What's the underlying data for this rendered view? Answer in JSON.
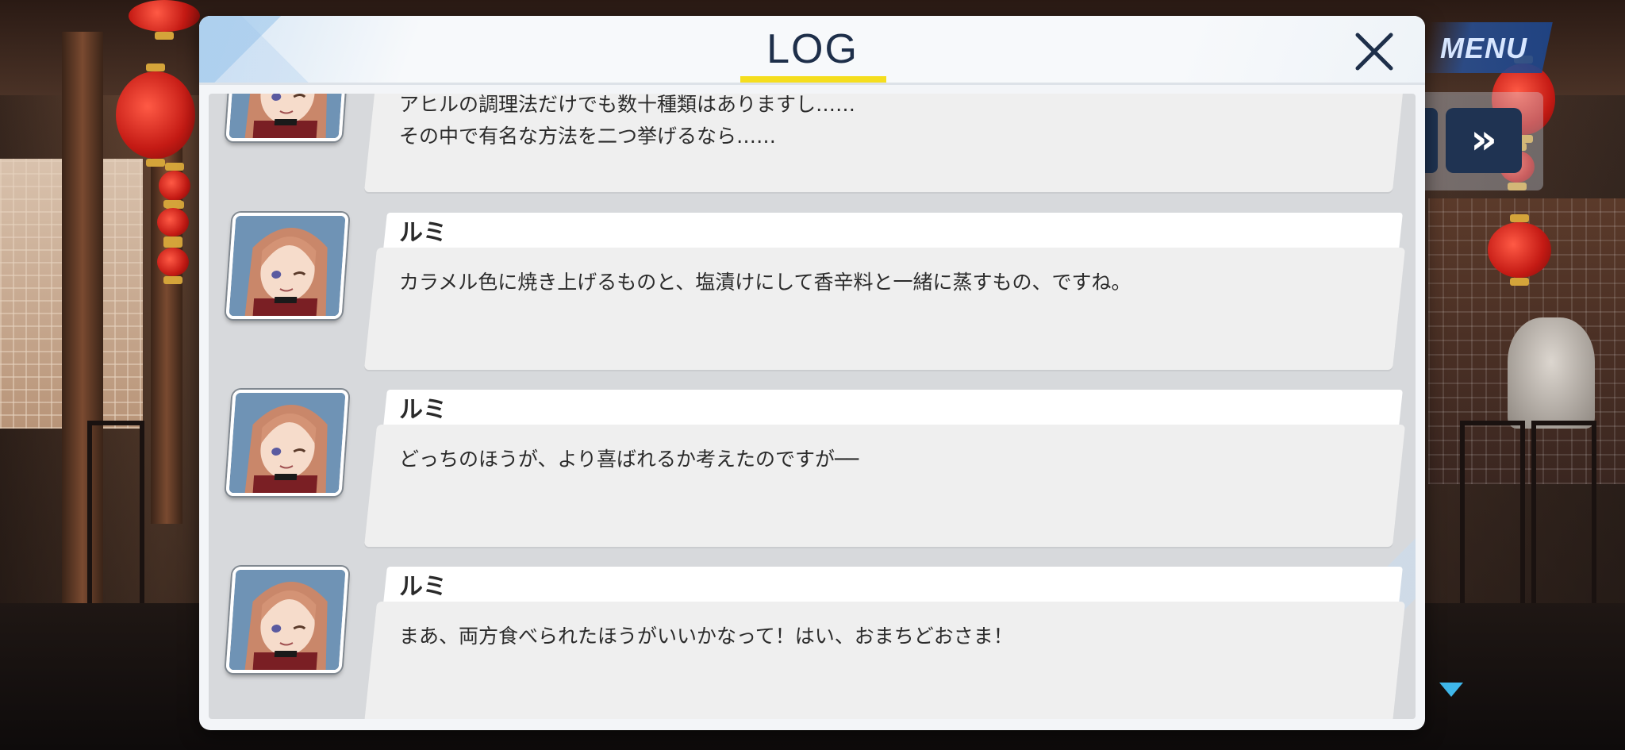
{
  "hud": {
    "menu_label": "MENU",
    "skip_glyph": "»"
  },
  "log": {
    "title": "LOG",
    "close_glyph": "×",
    "entries": [
      {
        "speaker": "",
        "text": "アヒルの調理法だけでも数十種類はありますし……\nその中で有名な方法を二つ挙げるなら……"
      },
      {
        "speaker": "ルミ",
        "text": "カラメル色に焼き上げるものと、塩漬けにして香辛料と一緒に蒸すもの、ですね。"
      },
      {
        "speaker": "ルミ",
        "text": "どっちのほうが、より喜ばれるか考えたのですが──"
      },
      {
        "speaker": "ルミ",
        "text": "まあ、両方食べられたほうがいいかなって！はい、おまちどおさま！"
      }
    ]
  },
  "colors": {
    "accent_underline": "#f5de1e",
    "title_text": "#1e2f4a",
    "menu_blue": "#2a4f8f",
    "indicator": "#3fb7ea"
  }
}
